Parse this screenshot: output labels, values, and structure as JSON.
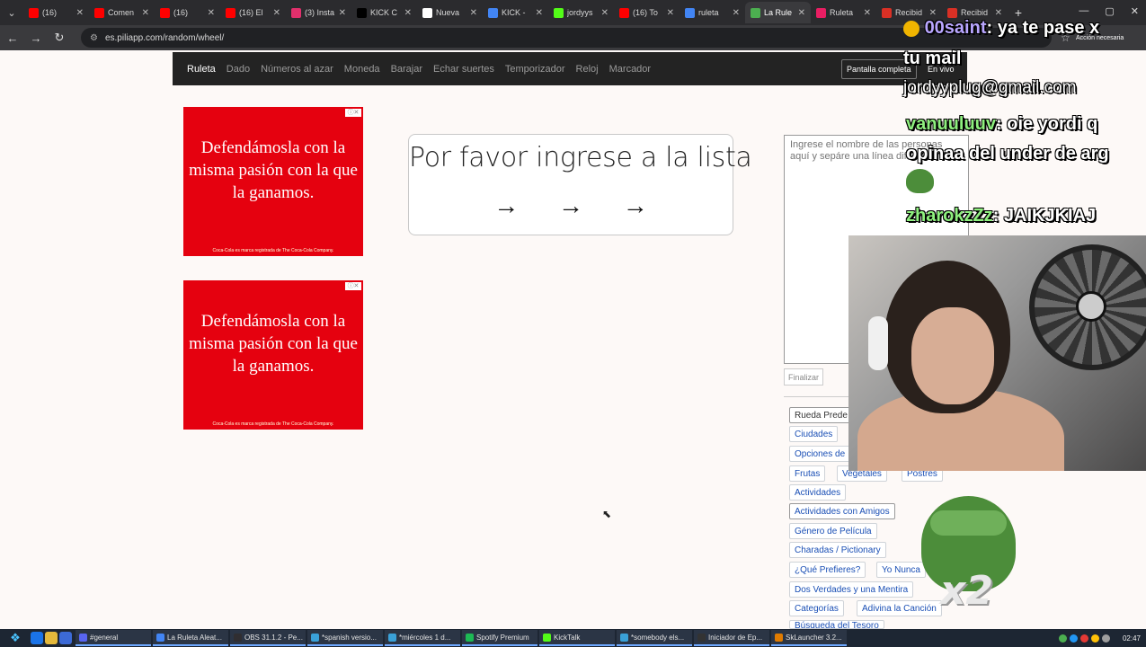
{
  "browser": {
    "tabs": [
      {
        "label": "(16)",
        "color": "#ff0000"
      },
      {
        "label": "Comen",
        "color": "#ff0000"
      },
      {
        "label": "(16)",
        "color": "#ff0000"
      },
      {
        "label": "(16) El",
        "color": "#ff0000"
      },
      {
        "label": "(3) Insta",
        "color": "#e1306c"
      },
      {
        "label": "KICK C",
        "color": "#000000"
      },
      {
        "label": "Nueva",
        "color": "#ffffff"
      },
      {
        "label": "KICK -",
        "color": "#4285f4"
      },
      {
        "label": "jordyys",
        "color": "#53fc18"
      },
      {
        "label": "(16) To",
        "color": "#ff0000"
      },
      {
        "label": "ruleta",
        "color": "#4285f4"
      },
      {
        "label": "La Rule",
        "color": "#4caf50",
        "active": true
      },
      {
        "label": "Ruleta",
        "color": "#e91e63"
      },
      {
        "label": "Recibid",
        "color": "#d93025"
      },
      {
        "label": "Recibid",
        "color": "#d93025"
      }
    ],
    "new_tab": "+",
    "url": "es.piliapp.com/random/wheel/"
  },
  "site_nav": {
    "items": [
      "Ruleta",
      "Dado",
      "Números al azar",
      "Moneda",
      "Barajar",
      "Echar suertes",
      "Temporizador",
      "Reloj",
      "Marcador"
    ],
    "fullscreen": "Pantalla completa",
    "live": "En vivo"
  },
  "ads": {
    "headline": "Defendámosla con la misma pasión con la que la ganamos.",
    "fine_print": "Coca-Cola es marca registrada de The Coca-Cola Company."
  },
  "wheel": {
    "prompt": "Por favor ingrese a la lista",
    "arrows": "→ → →"
  },
  "names": {
    "placeholder": "Ingrese el nombre de las personas aquí y sepáre una línea diferente.",
    "finalize": "Finalizar"
  },
  "presets": {
    "items": [
      "Rueda Prede",
      "Ciudades",
      "Opciones de",
      "Frutas",
      "Vegetales",
      "Postres",
      "Actividades",
      "Actividades con Amigos",
      "Género de Película",
      "Charadas / Pictionary",
      "¿Qué Prefieres?",
      "Yo Nunca",
      "Dos Verdades y una Mentira",
      "Categorías",
      "Adivina la Canción",
      "Búsqueda del Tesoro"
    ]
  },
  "overlay": {
    "chat1_user": "00saint",
    "chat1_msg": ": ya te pase x",
    "chat1_cont": "tu mail",
    "chat2": "jordyyplug@gmail.com",
    "chat3_user": "vanuuluuv",
    "chat3_msg": ": oie yordi q",
    "chat3_cont": "opinaa del under de arg",
    "chat4_user": "zharokzZz",
    "chat4_msg": ": JAIKJKIAJ",
    "badge": "x2",
    "action_text": "Acción necesaria"
  },
  "taskbar": {
    "items": [
      {
        "label": "#general",
        "color": "#5865f2"
      },
      {
        "label": "La Ruleta Aleat...",
        "color": "#4285f4"
      },
      {
        "label": "OBS 31.1.2 - Pe...",
        "color": "#302e31"
      },
      {
        "label": "*spanish versio...",
        "color": "#3aa1d8"
      },
      {
        "label": "*miércoles 1 d...",
        "color": "#3aa1d8"
      },
      {
        "label": "Spotify Premium",
        "color": "#1db954"
      },
      {
        "label": "KickTalk",
        "color": "#53fc18"
      },
      {
        "label": "*somebody els...",
        "color": "#3aa1d8"
      },
      {
        "label": "Iniciador de Ep...",
        "color": "#333333"
      },
      {
        "label": "SkLauncher 3.2...",
        "color": "#e07b00"
      }
    ],
    "clock": "02:47"
  }
}
